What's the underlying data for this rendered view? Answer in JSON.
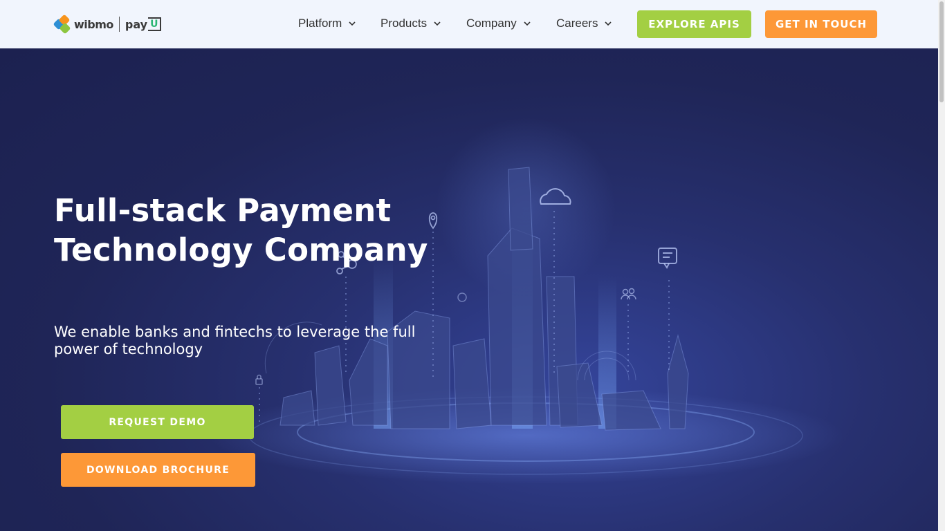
{
  "brand": {
    "name": "wibmo",
    "partner": "pay",
    "partner_suffix": "U",
    "colors": {
      "blue": "#2d8fd5",
      "orange": "#f7941d",
      "green": "#8dc63f"
    }
  },
  "nav": {
    "items": [
      {
        "label": "Platform",
        "icon": "chevron-down-icon"
      },
      {
        "label": "Products",
        "icon": "chevron-down-icon"
      },
      {
        "label": "Company",
        "icon": "chevron-down-icon"
      },
      {
        "label": "Careers",
        "icon": "chevron-down-icon"
      }
    ],
    "explore_label": "EXPLORE APIS",
    "touch_label": "GET IN TOUCH"
  },
  "hero": {
    "title": "Full-stack Payment Technology Company",
    "subtitle": "We enable banks and fintechs to leverage the full power of technology",
    "demo_label": "REQUEST DEMO",
    "brochure_label": "DOWNLOAD BROCHURE",
    "icons": [
      "cloud-icon",
      "location-pin-icon",
      "share-nodes-icon",
      "chat-icon",
      "users-icon",
      "lock-icon"
    ]
  },
  "colors": {
    "accent_green": "#a3cf43",
    "accent_orange": "#fd9837",
    "hero_bg": "#1f2557",
    "header_bg": "#f1f5fd"
  }
}
